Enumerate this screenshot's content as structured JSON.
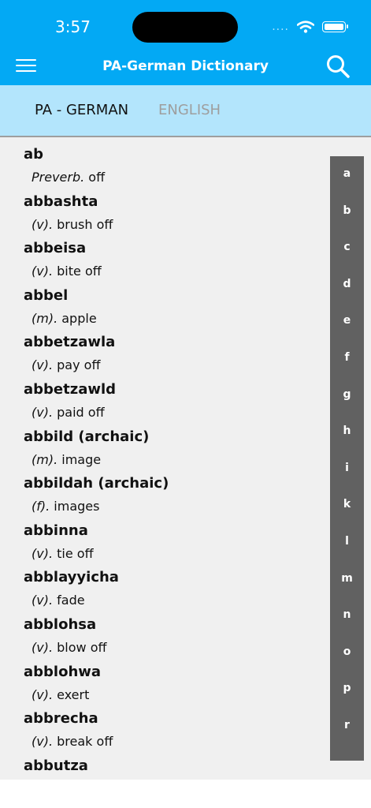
{
  "status_bar": {
    "time": "3:57",
    "signal_dots": "....",
    "battery_level": 1.0
  },
  "header": {
    "title": "PA-German Dictionary",
    "menu_icon": "hamburger-menu-icon",
    "search_icon": "search-icon"
  },
  "tabs": [
    {
      "label": "PA - GERMAN",
      "active": true
    },
    {
      "label": "ENGLISH",
      "active": false
    }
  ],
  "entries": [
    {
      "word": "ab",
      "pos": "Preverb.",
      "meaning": "off"
    },
    {
      "word": "abbashta",
      "pos": "(v).",
      "meaning": "brush off"
    },
    {
      "word": "abbeisa",
      "pos": "(v).",
      "meaning": "bite off"
    },
    {
      "word": "abbel",
      "pos": "(m).",
      "meaning": "apple"
    },
    {
      "word": "abbetzawla",
      "pos": "(v).",
      "meaning": "pay off"
    },
    {
      "word": "abbetzawld",
      "pos": "(v).",
      "meaning": "paid off"
    },
    {
      "word": "abbild (archaic)",
      "pos": "(m).",
      "meaning": "image"
    },
    {
      "word": "abbildah (archaic)",
      "pos": "(f).",
      "meaning": "images"
    },
    {
      "word": "abbinna",
      "pos": "(v).",
      "meaning": "tie off"
    },
    {
      "word": "abblayyicha",
      "pos": "(v).",
      "meaning": "fade"
    },
    {
      "word": "abblohsa",
      "pos": "(v).",
      "meaning": "blow off"
    },
    {
      "word": "abblohwa",
      "pos": "(v).",
      "meaning": "exert"
    },
    {
      "word": "abbrecha",
      "pos": "(v).",
      "meaning": "break off"
    },
    {
      "word": "abbutza",
      "pos": "",
      "meaning": ""
    }
  ],
  "index_letters": [
    "a",
    "b",
    "c",
    "d",
    "e",
    "f",
    "g",
    "h",
    "i",
    "k",
    "l",
    "m",
    "n",
    "o",
    "p",
    "r"
  ],
  "colors": {
    "header": "#03a9f4",
    "tab_bar": "#b3e5fc",
    "list_bg": "#f0f0f0",
    "index_bg": "#616161"
  }
}
